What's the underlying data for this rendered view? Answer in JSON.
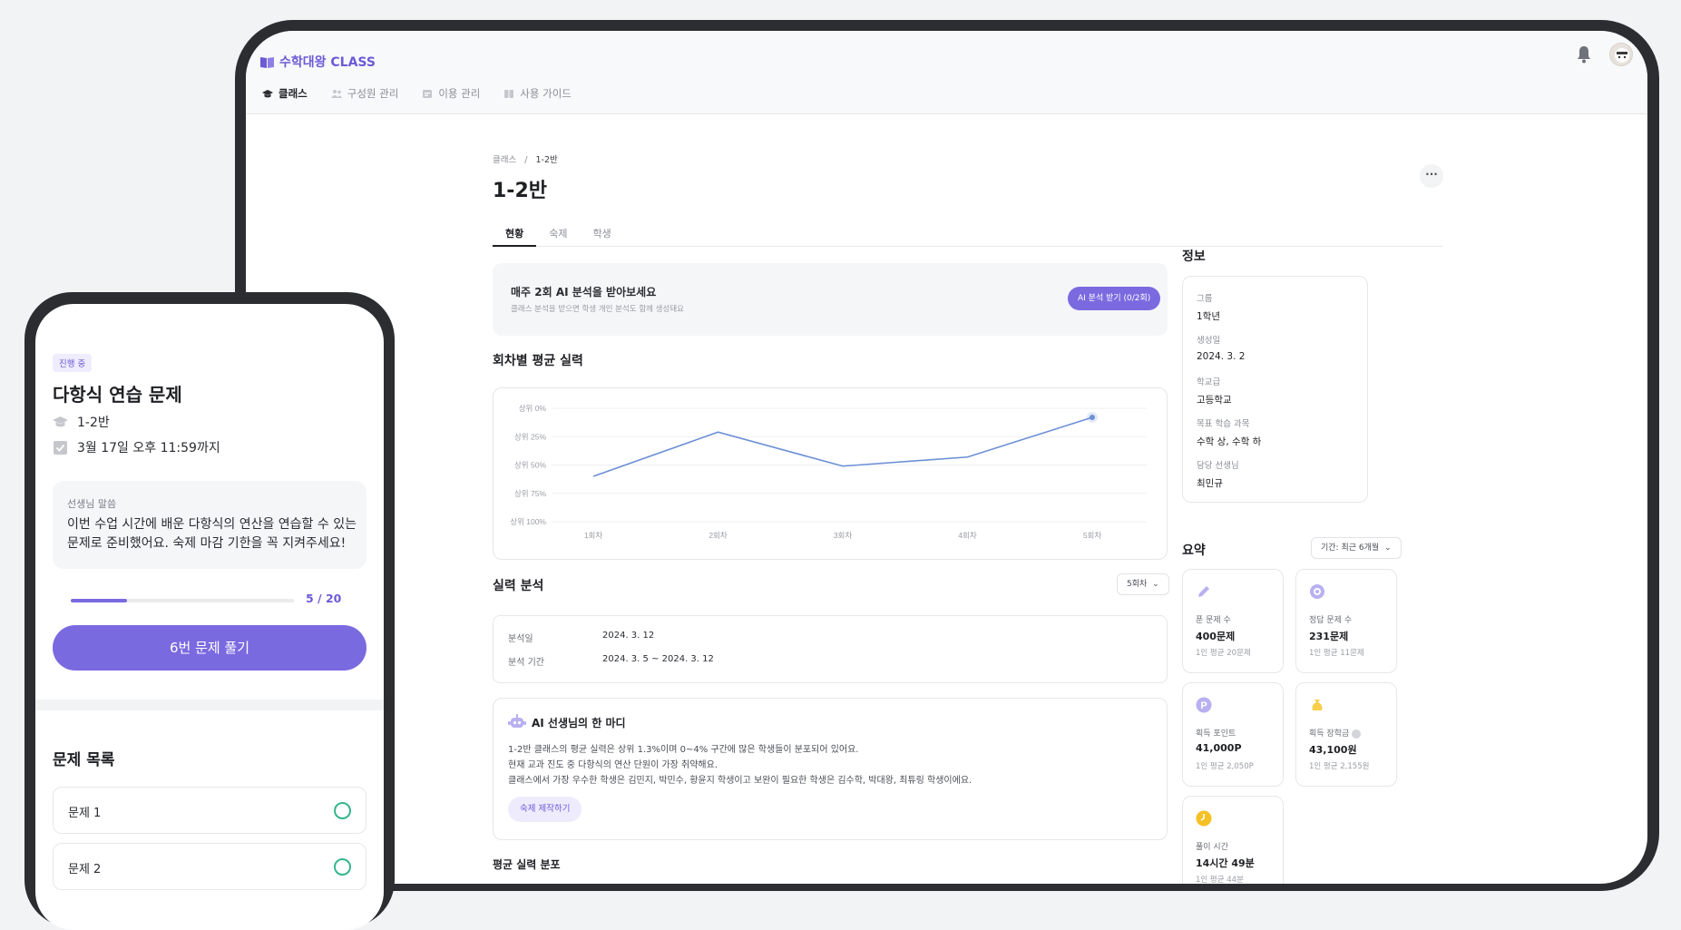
{
  "app": {
    "brand": "수학대왕 CLASS"
  },
  "nav": [
    {
      "label": "클래스",
      "active": true,
      "icon": "graduation-cap-icon"
    },
    {
      "label": "구성원 관리",
      "active": false,
      "icon": "users-icon"
    },
    {
      "label": "이용 관리",
      "active": false,
      "icon": "card-icon"
    },
    {
      "label": "사용 가이드",
      "active": false,
      "icon": "guide-icon"
    }
  ],
  "breadcrumb": {
    "root": "클래스",
    "sep": "/",
    "current": "1-2반"
  },
  "page": {
    "title": "1-2반",
    "more": "···"
  },
  "tabs": [
    "현황",
    "숙제",
    "학생"
  ],
  "banner": {
    "title": "매주 2회 AI 분석을 받아보세요",
    "subtitle": "클래스 분석을 받으면 학생 개인 분석도 함께 생성돼요",
    "button": "AI 분석 받기 (0/2회)"
  },
  "chart_section": {
    "title": "회차별 평균 실력"
  },
  "chart_data": {
    "type": "line",
    "categories": [
      "1회차",
      "2회차",
      "3회차",
      "4회차",
      "5회차"
    ],
    "y_tick_labels": [
      "상위 0%",
      "상위 25%",
      "상위 50%",
      "상위 75%",
      "상위 100%"
    ],
    "ylim": [
      0,
      100
    ],
    "y_inverted": true,
    "values": [
      60,
      21,
      51,
      43,
      8
    ],
    "highlight_last_point": true,
    "line_color": "#6c8fd6",
    "grid": true
  },
  "analysis": {
    "title": "실력 분석",
    "select": "5회차",
    "rows": [
      {
        "key": "분석일",
        "value": "2024. 3. 12"
      },
      {
        "key": "분석 기간",
        "value": "2024. 3. 5 ~ 2024. 3. 12"
      }
    ]
  },
  "ai_comment": {
    "title": "AI 선생님의 한 마디",
    "lines": [
      "1-2반 클래스의 평균 실력은 상위 1.3%이며 0~4% 구간에 많은 학생들이 분포되어 있어요.",
      "현재 교과 진도 중 다항식의 연산 단원이 가장 취약해요.",
      "클래스에서 가장 우수한 학생은 김민지, 박민수, 황윤지 학생이고 보완이 필요한 학생은 김수학, 박대왕, 최튜링 학생이에요."
    ],
    "button": "숙제 제작하기"
  },
  "distribution": {
    "title": "평균 실력 분포"
  },
  "info": {
    "title": "정보",
    "items": [
      {
        "label": "그룹",
        "value": "1학년"
      },
      {
        "label": "생성일",
        "value": "2024. 3. 2"
      },
      {
        "label": "학교급",
        "value": "고등학교"
      },
      {
        "label": "목표 학습 과목",
        "value": "수학 상, 수학 하"
      },
      {
        "label": "담당 선생님",
        "value": "최민규"
      }
    ]
  },
  "summary": {
    "title": "요약",
    "period": "기간: 최근 6개월",
    "cards": [
      {
        "label": "푼 문제 수",
        "value": "400문제",
        "sub": "1인 평균 20문제",
        "icon": "pencil-icon",
        "color": "#b8b0f0"
      },
      {
        "label": "정답 문제 수",
        "value": "231문제",
        "sub": "1인 평균 11문제",
        "icon": "target-icon",
        "color": "#b8b0f0"
      },
      {
        "label": "획득 포인트",
        "value": "41,000P",
        "sub": "1인 평균 2,050P",
        "icon": "point-icon",
        "color": "#b8b0f0"
      },
      {
        "label": "획득 장학금",
        "value": "43,100원",
        "sub": "1인 평균 2,155원",
        "icon": "money-bag-icon",
        "color": "#f7cf4a"
      },
      {
        "label": "풀이 시간",
        "value": "14시간 49분",
        "sub": "1인 평균 44분",
        "icon": "clock-icon",
        "color": "#f5c024"
      }
    ]
  },
  "phone": {
    "status_pill": "진행 중",
    "title": "다항식 연습 문제",
    "class_name": "1-2반",
    "deadline": "3월 17일 오후 11:59까지",
    "memo_label": "선생님 말씀",
    "memo_text": "이번 수업 시간에 배운 다항식의 연산을 연습할 수 있는 문제로 준비했어요. 숙제 마감 기한을 꼭 지켜주세요!",
    "progress_text": "5 / 20",
    "progress_fraction": 0.25,
    "solve_button": "6번 문제 풀기",
    "list_title": "문제 목록",
    "questions": [
      "문제 1",
      "문제 2"
    ]
  }
}
